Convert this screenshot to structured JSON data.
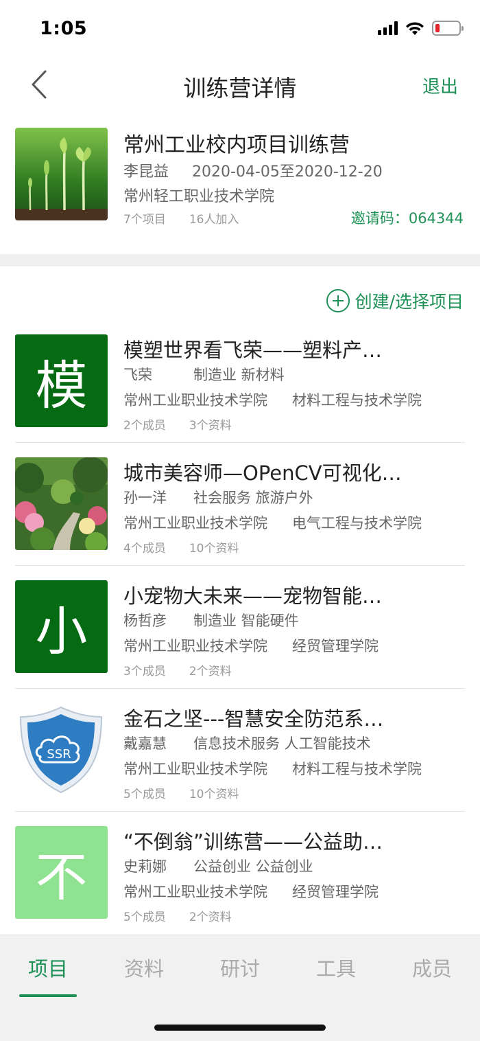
{
  "status": {
    "time": "1:05"
  },
  "nav": {
    "title": "训练营详情",
    "exit_label": "退出"
  },
  "camp": {
    "name": "常州工业校内项目训练营",
    "leader": "李昆益",
    "date_range": "2020-04-05至2020-12-20",
    "school": "常州轻工职业技术学院",
    "project_count": "7个项目",
    "member_count": "16人加入",
    "invite_code": "邀请码：064344"
  },
  "create_label": "创建/选择项目",
  "projects": [
    {
      "title": "模塑世界看飞荣——塑料产…",
      "owner": "飞荣",
      "tags": "制造业  新材料",
      "school": "常州工业职业技术学院",
      "dept": "材料工程与技术学院",
      "members": "2个成员",
      "docs": "3个资料",
      "thumb_char": "模",
      "thumb_color": "#046b12"
    },
    {
      "title": "城市美容师—OPenCV可视化…",
      "owner": "孙一洋",
      "tags": "社会服务  旅游户外",
      "school": "常州工业职业技术学院",
      "dept": "电气工程与技术学院",
      "members": "4个成员",
      "docs": "10个资料",
      "thumb_char": "",
      "thumb_color": ""
    },
    {
      "title": "小宠物大未来——宠物智能…",
      "owner": "杨哲彦",
      "tags": "制造业  智能硬件",
      "school": "常州工业职业技术学院",
      "dept": "经贸管理学院",
      "members": "3个成员",
      "docs": "2个资料",
      "thumb_char": "小",
      "thumb_color": "#046b12"
    },
    {
      "title": "金石之坚---智慧安全防范系…",
      "owner": "戴嘉慧",
      "tags": "信息技术服务  人工智能技术",
      "school": "常州工业职业技术学院",
      "dept": "材料工程与技术学院",
      "members": "5个成员",
      "docs": "10个资料",
      "thumb_char": "",
      "thumb_color": "",
      "logo_text": "SSR"
    },
    {
      "title": "“不倒翁”训练营——公益助…",
      "owner": "史莉娜",
      "tags": "公益创业  公益创业",
      "school": "常州工业职业技术学院",
      "dept": "经贸管理学院",
      "members": "5个成员",
      "docs": "2个资料",
      "thumb_char": "不",
      "thumb_color": "#8fe28f"
    }
  ],
  "tabs": [
    {
      "label": "项目",
      "active": true
    },
    {
      "label": "资料",
      "active": false
    },
    {
      "label": "研讨",
      "active": false
    },
    {
      "label": "工具",
      "active": false
    },
    {
      "label": "成员",
      "active": false
    }
  ],
  "colors": {
    "accent": "#1e9157",
    "dark_green": "#046b12",
    "light_green": "#8fe28f"
  }
}
